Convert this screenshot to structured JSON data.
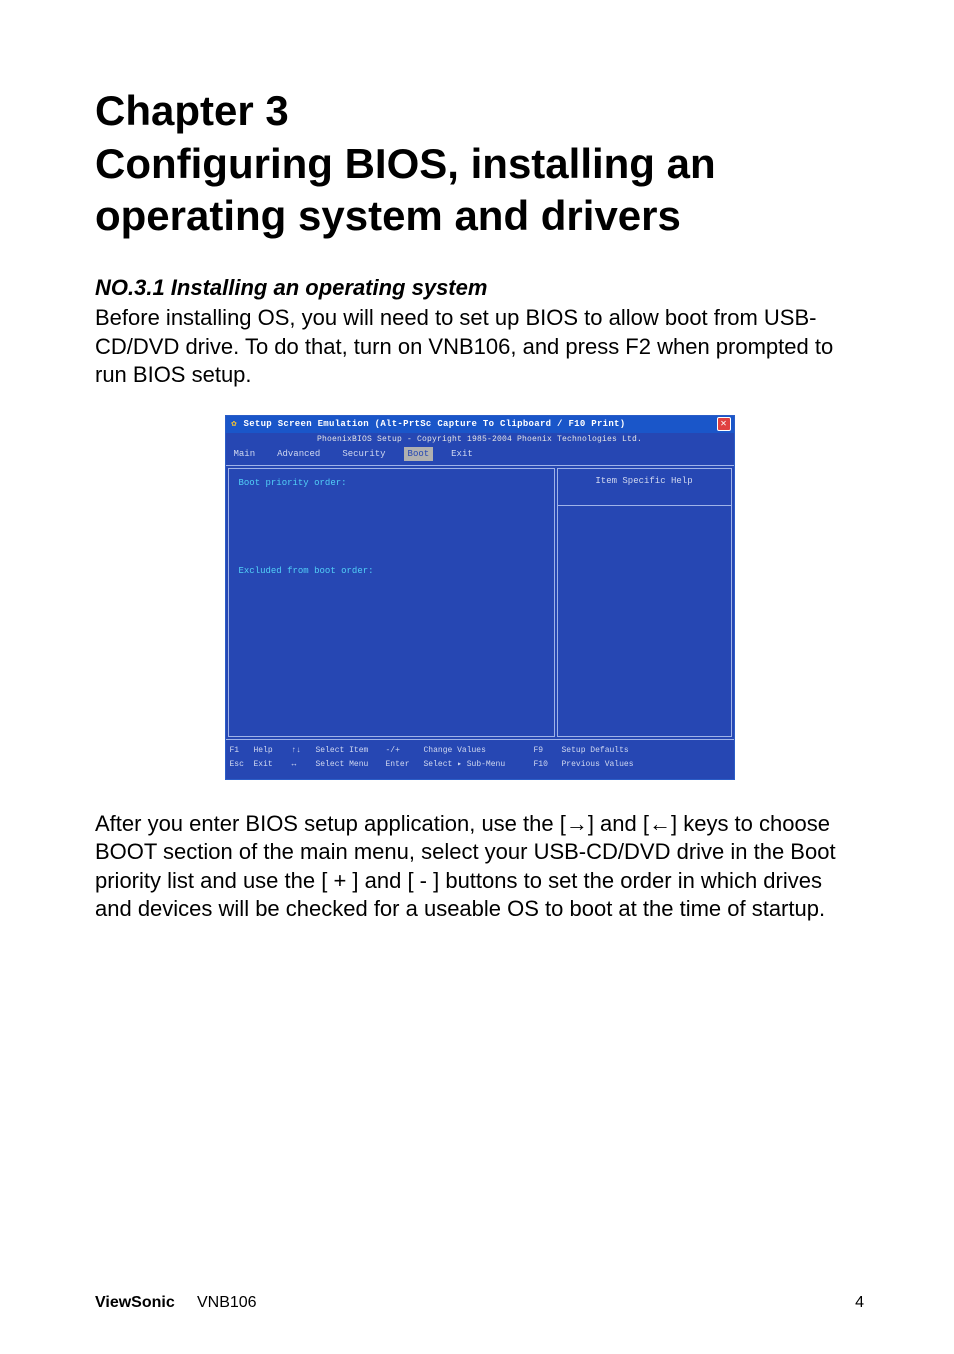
{
  "heading": "Chapter 3\nConfiguring BIOS, installing an operating system and drivers",
  "section": {
    "title": "NO.3.1 Installing an operating system",
    "para1": "Before installing OS, you will need to set up BIOS to allow boot from USB-CD/DVD drive. To do that, turn on VNB106, and press F2 when prompted to run BIOS setup.",
    "para2": "After you enter BIOS setup application, use the [→] and [←] keys to choose BOOT section of the main menu, select your USB-CD/DVD drive in the Boot priority list and use the [ + ] and [ - ] buttons to set the order in which drives and devices will be checked for a useable OS to boot at the time of startup."
  },
  "bios": {
    "titlebar": "Setup Screen Emulation (Alt-PrtSc Capture To Clipboard / F10 Print)",
    "close_glyph": "✕",
    "gear_glyph": "✿",
    "copyright": "PhoenixBIOS Setup - Copyright 1985-2004 Phoenix Technologies Ltd.",
    "menu": {
      "items": [
        "Main",
        "Advanced",
        "Security",
        "Boot",
        "Exit"
      ],
      "active": "Boot"
    },
    "left": {
      "row1": "Boot priority order:",
      "row2": "Excluded from boot order:"
    },
    "right": {
      "header": "Item Specific Help"
    },
    "keys": {
      "r1": [
        "F1",
        "Help",
        "↑↓",
        "Select Item",
        "-/+",
        "Change Values",
        "F9",
        "Setup Defaults"
      ],
      "r2": [
        "Esc",
        "Exit",
        "↔",
        "Select Menu",
        "Enter",
        "Select ▸ Sub-Menu",
        "F10",
        "Previous Values"
      ]
    }
  },
  "footer": {
    "brand": "ViewSonic",
    "model": "VNB106",
    "page": "4"
  }
}
